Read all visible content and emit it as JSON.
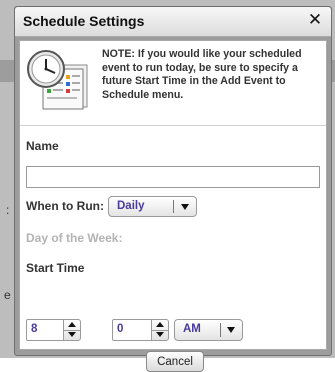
{
  "dialog": {
    "title": "Schedule Settings",
    "close_glyph": "✕",
    "note": "NOTE: If you would like your scheduled event to run today, be sure to specify a future Start Time in the Add Event to Schedule menu.",
    "illustration_icon": "clock-calendar-icon"
  },
  "form": {
    "name_label": "Name",
    "name_value": "",
    "when_label": "When to Run:",
    "when_value": "Daily",
    "day_of_week_label": "Day of the Week:",
    "start_time_label": "Start Time",
    "hour_value": "8",
    "colon": ":",
    "minute_value": "0",
    "ampm_value": "AM",
    "cancel_label": "Cancel"
  },
  "colors": {
    "overlay_bg": "#9c9c9c",
    "value_text": "#4a3a9a",
    "disabled_label": "#b3b3b3"
  }
}
